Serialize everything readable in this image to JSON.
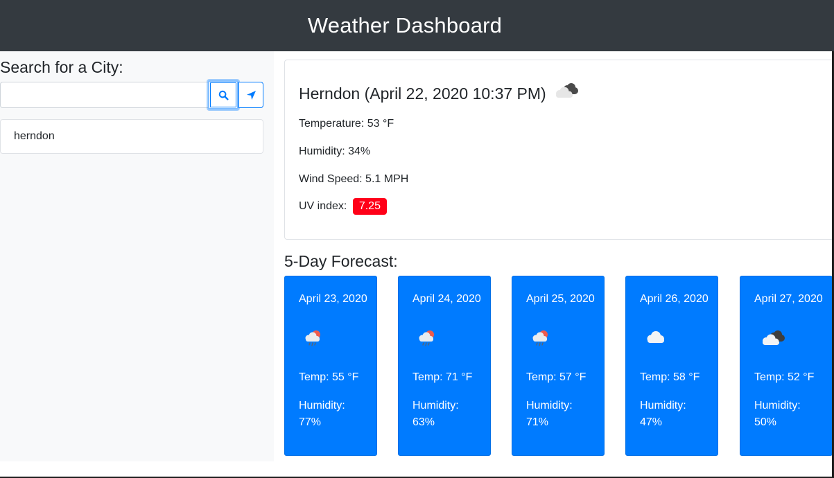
{
  "header": {
    "title": "Weather Dashboard"
  },
  "sidebar": {
    "heading": "Search for a City:",
    "search": {
      "placeholder": "",
      "value": ""
    },
    "search_icon": "search-icon",
    "locate_icon": "location-arrow-icon",
    "history": [
      "herndon"
    ]
  },
  "current": {
    "title": "Herndon (April 22, 2020 10:37 PM)",
    "icon": "broken-clouds-icon",
    "temperature": "Temperature: 53 °F",
    "humidity": "Humidity: 34%",
    "wind": "Wind Speed: 5.1 MPH",
    "uv_label": "UV index:",
    "uv_value": "7.25",
    "uv_color": "#ff0018"
  },
  "forecast": {
    "heading": "5-Day Forecast:",
    "card_color": "#007bff",
    "days": [
      {
        "date": "April 23, 2020",
        "icon": "rain-sun-icon",
        "temp": "Temp: 55 °F",
        "humidity": "Humidity: 77%"
      },
      {
        "date": "April 24, 2020",
        "icon": "rain-sun-icon",
        "temp": "Temp: 71 °F",
        "humidity": "Humidity: 63%"
      },
      {
        "date": "April 25, 2020",
        "icon": "rain-sun-icon",
        "temp": "Temp: 57 °F",
        "humidity": "Humidity: 71%"
      },
      {
        "date": "April 26, 2020",
        "icon": "cloud-icon",
        "temp": "Temp: 58 °F",
        "humidity": "Humidity: 47%"
      },
      {
        "date": "April 27, 2020",
        "icon": "broken-clouds-icon",
        "temp": "Temp: 52 °F",
        "humidity": "Humidity: 50%"
      }
    ]
  }
}
